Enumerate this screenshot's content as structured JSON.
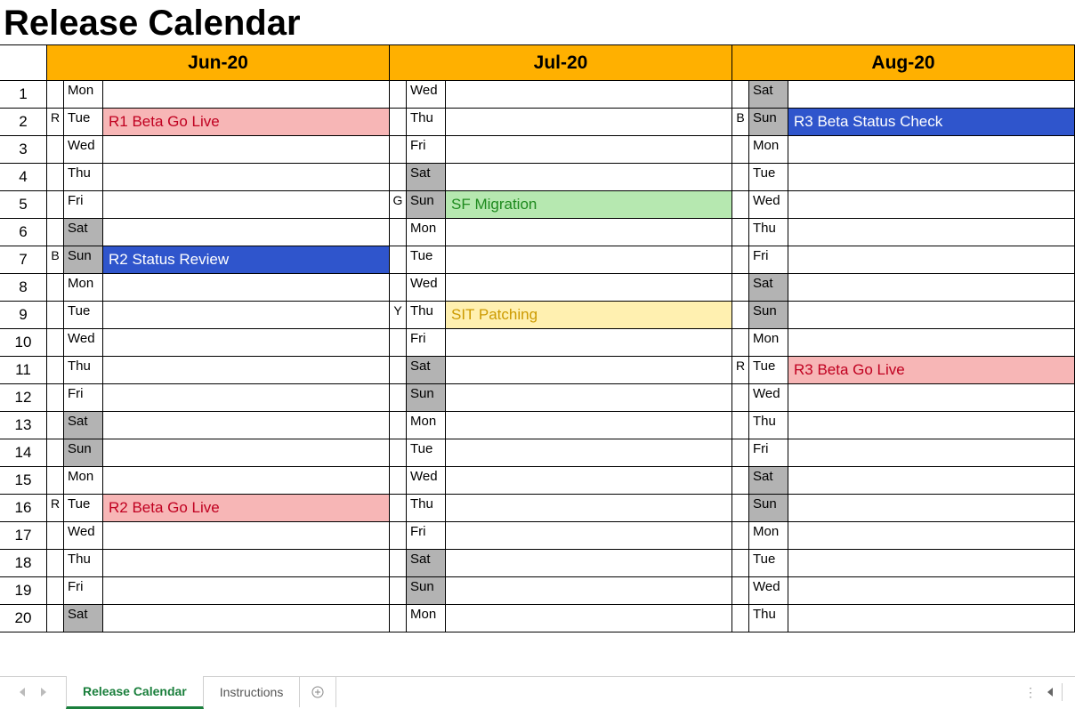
{
  "title": "Release Calendar",
  "months": [
    "Jun-20",
    "Jul-20",
    "Aug-20"
  ],
  "tabs": {
    "active": "Release Calendar",
    "items": [
      "Release Calendar",
      "Instructions"
    ]
  },
  "color_legend": {
    "R": "red",
    "B": "blue",
    "G": "green",
    "Y": "yellow"
  },
  "rows": [
    {
      "n": 1,
      "cells": [
        {
          "code": "",
          "dow": "Mon",
          "weekend": false,
          "event": "",
          "style": ""
        },
        {
          "code": "",
          "dow": "Wed",
          "weekend": false,
          "event": "",
          "style": ""
        },
        {
          "code": "",
          "dow": "Sat",
          "weekend": true,
          "event": "",
          "style": ""
        }
      ]
    },
    {
      "n": 2,
      "cells": [
        {
          "code": "R",
          "dow": "Tue",
          "weekend": false,
          "event": "R1 Beta Go Live",
          "style": "red"
        },
        {
          "code": "",
          "dow": "Thu",
          "weekend": false,
          "event": "",
          "style": ""
        },
        {
          "code": "B",
          "dow": "Sun",
          "weekend": true,
          "event": "R3 Beta Status Check",
          "style": "blue"
        }
      ]
    },
    {
      "n": 3,
      "cells": [
        {
          "code": "",
          "dow": "Wed",
          "weekend": false,
          "event": "",
          "style": ""
        },
        {
          "code": "",
          "dow": "Fri",
          "weekend": false,
          "event": "",
          "style": ""
        },
        {
          "code": "",
          "dow": "Mon",
          "weekend": false,
          "event": "",
          "style": ""
        }
      ]
    },
    {
      "n": 4,
      "cells": [
        {
          "code": "",
          "dow": "Thu",
          "weekend": false,
          "event": "",
          "style": ""
        },
        {
          "code": "",
          "dow": "Sat",
          "weekend": true,
          "event": "",
          "style": ""
        },
        {
          "code": "",
          "dow": "Tue",
          "weekend": false,
          "event": "",
          "style": ""
        }
      ]
    },
    {
      "n": 5,
      "cells": [
        {
          "code": "",
          "dow": "Fri",
          "weekend": false,
          "event": "",
          "style": ""
        },
        {
          "code": "G",
          "dow": "Sun",
          "weekend": true,
          "event": "SF Migration",
          "style": "green"
        },
        {
          "code": "",
          "dow": "Wed",
          "weekend": false,
          "event": "",
          "style": ""
        }
      ]
    },
    {
      "n": 6,
      "cells": [
        {
          "code": "",
          "dow": "Sat",
          "weekend": true,
          "event": "",
          "style": ""
        },
        {
          "code": "",
          "dow": "Mon",
          "weekend": false,
          "event": "",
          "style": ""
        },
        {
          "code": "",
          "dow": "Thu",
          "weekend": false,
          "event": "",
          "style": ""
        }
      ]
    },
    {
      "n": 7,
      "cells": [
        {
          "code": "B",
          "dow": "Sun",
          "weekend": true,
          "event": "R2 Status Review",
          "style": "blue"
        },
        {
          "code": "",
          "dow": "Tue",
          "weekend": false,
          "event": "",
          "style": ""
        },
        {
          "code": "",
          "dow": "Fri",
          "weekend": false,
          "event": "",
          "style": ""
        }
      ]
    },
    {
      "n": 8,
      "cells": [
        {
          "code": "",
          "dow": "Mon",
          "weekend": false,
          "event": "",
          "style": ""
        },
        {
          "code": "",
          "dow": "Wed",
          "weekend": false,
          "event": "",
          "style": ""
        },
        {
          "code": "",
          "dow": "Sat",
          "weekend": true,
          "event": "",
          "style": ""
        }
      ]
    },
    {
      "n": 9,
      "cells": [
        {
          "code": "",
          "dow": "Tue",
          "weekend": false,
          "event": "",
          "style": ""
        },
        {
          "code": "Y",
          "dow": "Thu",
          "weekend": false,
          "event": "SIT Patching",
          "style": "yellow"
        },
        {
          "code": "",
          "dow": "Sun",
          "weekend": true,
          "event": "",
          "style": ""
        }
      ]
    },
    {
      "n": 10,
      "cells": [
        {
          "code": "",
          "dow": "Wed",
          "weekend": false,
          "event": "",
          "style": ""
        },
        {
          "code": "",
          "dow": "Fri",
          "weekend": false,
          "event": "",
          "style": ""
        },
        {
          "code": "",
          "dow": "Mon",
          "weekend": false,
          "event": "",
          "style": ""
        }
      ]
    },
    {
      "n": 11,
      "cells": [
        {
          "code": "",
          "dow": "Thu",
          "weekend": false,
          "event": "",
          "style": ""
        },
        {
          "code": "",
          "dow": "Sat",
          "weekend": true,
          "event": "",
          "style": ""
        },
        {
          "code": "R",
          "dow": "Tue",
          "weekend": false,
          "event": "R3 Beta Go Live",
          "style": "red"
        }
      ]
    },
    {
      "n": 12,
      "cells": [
        {
          "code": "",
          "dow": "Fri",
          "weekend": false,
          "event": "",
          "style": ""
        },
        {
          "code": "",
          "dow": "Sun",
          "weekend": true,
          "event": "",
          "style": ""
        },
        {
          "code": "",
          "dow": "Wed",
          "weekend": false,
          "event": "",
          "style": ""
        }
      ]
    },
    {
      "n": 13,
      "cells": [
        {
          "code": "",
          "dow": "Sat",
          "weekend": true,
          "event": "",
          "style": ""
        },
        {
          "code": "",
          "dow": "Mon",
          "weekend": false,
          "event": "",
          "style": ""
        },
        {
          "code": "",
          "dow": "Thu",
          "weekend": false,
          "event": "",
          "style": ""
        }
      ]
    },
    {
      "n": 14,
      "cells": [
        {
          "code": "",
          "dow": "Sun",
          "weekend": true,
          "event": "",
          "style": ""
        },
        {
          "code": "",
          "dow": "Tue",
          "weekend": false,
          "event": "",
          "style": ""
        },
        {
          "code": "",
          "dow": "Fri",
          "weekend": false,
          "event": "",
          "style": ""
        }
      ]
    },
    {
      "n": 15,
      "cells": [
        {
          "code": "",
          "dow": "Mon",
          "weekend": false,
          "event": "",
          "style": ""
        },
        {
          "code": "",
          "dow": "Wed",
          "weekend": false,
          "event": "",
          "style": ""
        },
        {
          "code": "",
          "dow": "Sat",
          "weekend": true,
          "event": "",
          "style": ""
        }
      ]
    },
    {
      "n": 16,
      "cells": [
        {
          "code": "R",
          "dow": "Tue",
          "weekend": false,
          "event": "R2 Beta Go Live",
          "style": "red"
        },
        {
          "code": "",
          "dow": "Thu",
          "weekend": false,
          "event": "",
          "style": ""
        },
        {
          "code": "",
          "dow": "Sun",
          "weekend": true,
          "event": "",
          "style": ""
        }
      ]
    },
    {
      "n": 17,
      "cells": [
        {
          "code": "",
          "dow": "Wed",
          "weekend": false,
          "event": "",
          "style": ""
        },
        {
          "code": "",
          "dow": "Fri",
          "weekend": false,
          "event": "",
          "style": ""
        },
        {
          "code": "",
          "dow": "Mon",
          "weekend": false,
          "event": "",
          "style": ""
        }
      ]
    },
    {
      "n": 18,
      "cells": [
        {
          "code": "",
          "dow": "Thu",
          "weekend": false,
          "event": "",
          "style": ""
        },
        {
          "code": "",
          "dow": "Sat",
          "weekend": true,
          "event": "",
          "style": ""
        },
        {
          "code": "",
          "dow": "Tue",
          "weekend": false,
          "event": "",
          "style": ""
        }
      ]
    },
    {
      "n": 19,
      "cells": [
        {
          "code": "",
          "dow": "Fri",
          "weekend": false,
          "event": "",
          "style": ""
        },
        {
          "code": "",
          "dow": "Sun",
          "weekend": true,
          "event": "",
          "style": ""
        },
        {
          "code": "",
          "dow": "Wed",
          "weekend": false,
          "event": "",
          "style": ""
        }
      ]
    },
    {
      "n": 20,
      "cells": [
        {
          "code": "",
          "dow": "Sat",
          "weekend": true,
          "event": "",
          "style": ""
        },
        {
          "code": "",
          "dow": "Mon",
          "weekend": false,
          "event": "",
          "style": ""
        },
        {
          "code": "",
          "dow": "Thu",
          "weekend": false,
          "event": "",
          "style": ""
        }
      ]
    }
  ]
}
